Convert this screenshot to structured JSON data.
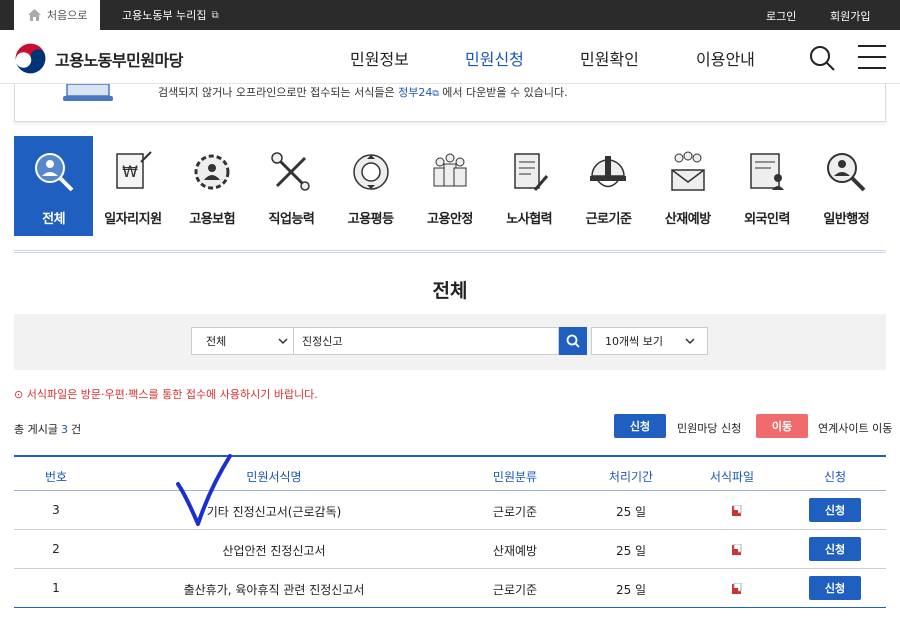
{
  "topbar": {
    "home_label": "처음으로",
    "portal_label": "고용노동부 누리집",
    "login_label": "로그인",
    "join_label": "회원가입"
  },
  "header": {
    "site_name": "고용노동부민원마당",
    "nav": [
      "민원정보",
      "민원신청",
      "민원확인",
      "이용안내"
    ],
    "active_nav": "민원신청"
  },
  "notice": {
    "text_before": "검색되지 않거나 오프라인으로만 접수되는 서식들은 ",
    "link": "정부24",
    "text_after": " 에서 다운받을 수 있습니다."
  },
  "categories": [
    {
      "label": "전체",
      "icon": "magnifier-person-icon",
      "active": true
    },
    {
      "label": "일자리지원",
      "icon": "won-document-icon"
    },
    {
      "label": "고용보험",
      "icon": "gear-person-icon"
    },
    {
      "label": "직업능력",
      "icon": "tools-icon"
    },
    {
      "label": "고용평등",
      "icon": "equality-circle-icon"
    },
    {
      "label": "고용안정",
      "icon": "people-group-icon"
    },
    {
      "label": "노사협력",
      "icon": "document-pen-icon"
    },
    {
      "label": "근로기준",
      "icon": "helmet-icon"
    },
    {
      "label": "산재예방",
      "icon": "people-mail-icon"
    },
    {
      "label": "외국인력",
      "icon": "document-person-icon"
    },
    {
      "label": "일반행정",
      "icon": "magnifier-person-icon"
    }
  ],
  "page_title": "전체",
  "search": {
    "scope": "전체",
    "query": "진정신고",
    "per_page": "10개씩 보기"
  },
  "warning": "⊙ 서식파일은 방문·우편·팩스를 통한 접수에 사용하시기 바랍니다.",
  "total": {
    "prefix": "총 게시글",
    "count": "3",
    "suffix": "건"
  },
  "legend": {
    "apply_btn": "신청",
    "apply_text": "민원마당 신청",
    "move_btn": "이동",
    "move_text": "연계사이트 이동"
  },
  "table": {
    "headers": [
      "번호",
      "민원서식명",
      "민원분류",
      "처리기간",
      "서식파일",
      "신청"
    ],
    "rows": [
      {
        "no": "3",
        "name": "기타 진정신고서(근로감독)",
        "category": "근로기준",
        "period": "25 일",
        "action": "신청"
      },
      {
        "no": "2",
        "name": "산업안전 진정신고서",
        "category": "산재예방",
        "period": "25 일",
        "action": "신청"
      },
      {
        "no": "1",
        "name": "출산휴가, 육아휴직 관련 진정신고서",
        "category": "근로기준",
        "period": "25 일",
        "action": "신청"
      }
    ]
  },
  "colors": {
    "primary": "#1e5fbf",
    "move": "#f06b6b",
    "warn": "#d9302c"
  }
}
